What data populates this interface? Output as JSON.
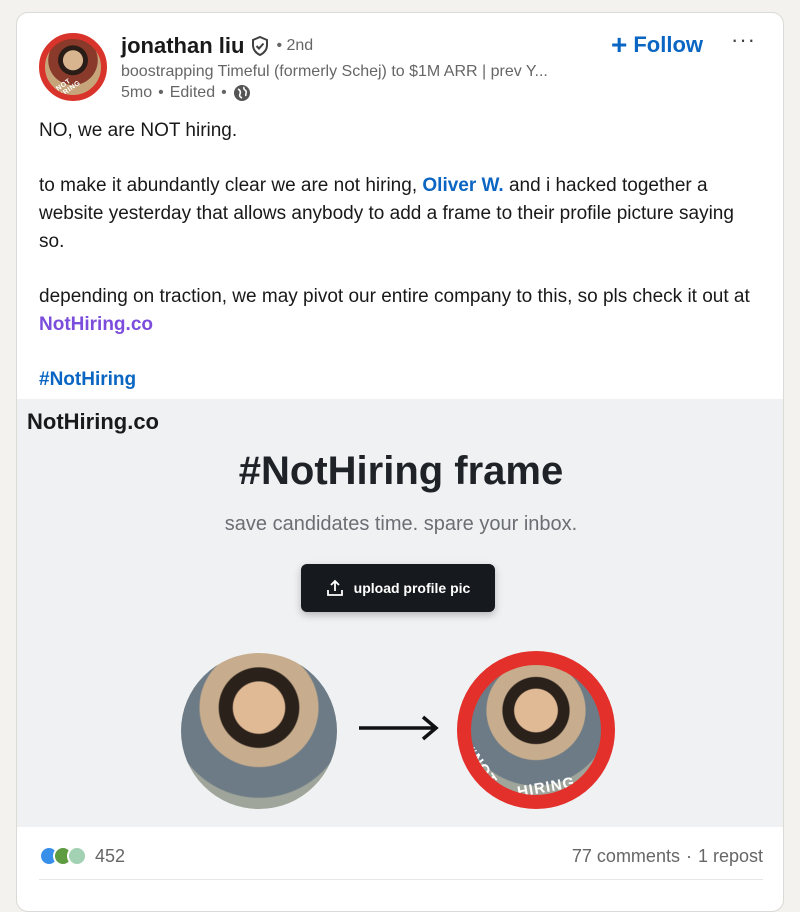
{
  "author": {
    "name": "jonathan liu",
    "degree": "2nd",
    "headline": "boostrapping Timeful (formerly Schej) to $1M ARR | prev Y...",
    "time": "5mo",
    "edited": "Edited",
    "avatar_badge": "#NOT HIRING"
  },
  "actions": {
    "follow_label": "Follow",
    "more_label": "···"
  },
  "post": {
    "line1": "NO, we are NOT hiring.",
    "p2_before": "to make it abundantly clear we are not hiring, ",
    "p2_mention": "Oliver W.",
    "p2_after": " and i hacked together a website yesterday that allows anybody to add a frame to their profile picture saying so.",
    "p3_before": "depending on traction, we may pivot our entire company to this, so pls check it out at ",
    "p3_link": "NotHiring.co",
    "hashtag": "#NotHiring"
  },
  "media": {
    "brand": "NotHiring.co",
    "title": "#NotHiring frame",
    "subtitle": "save candidates time. spare your inbox.",
    "upload_label": "upload profile pic",
    "ring_text_1": "#NOT",
    "ring_text_2": "HIRING"
  },
  "footer": {
    "reaction_count": "452",
    "comments": "77 comments",
    "separator": "·",
    "reposts": "1 repost"
  },
  "colors": {
    "brand_blue": "#0a66c2",
    "link_purple": "#7c4ddc",
    "frame_red": "#e3302b"
  }
}
